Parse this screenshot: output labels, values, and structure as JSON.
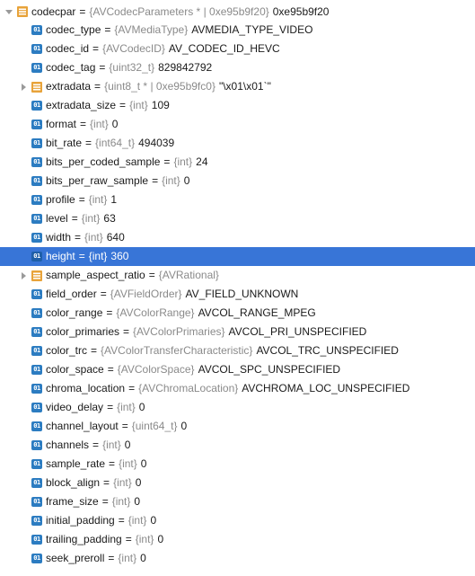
{
  "root": {
    "name": "codecpar",
    "type": "{AVCodecParameters * | 0xe95b9f20}",
    "value": "0xe95b9f20",
    "icon": "struct-icon",
    "expanded": true
  },
  "fields": [
    {
      "key": "codec_type",
      "name": "codec_type",
      "type": "{AVMediaType}",
      "value": "AVMEDIA_TYPE_VIDEO",
      "icon": "field-icon",
      "expandable": false
    },
    {
      "key": "codec_id",
      "name": "codec_id",
      "type": "{AVCodecID}",
      "value": "AV_CODEC_ID_HEVC",
      "icon": "field-icon",
      "expandable": false
    },
    {
      "key": "codec_tag",
      "name": "codec_tag",
      "type": "{uint32_t}",
      "value": "829842792",
      "icon": "field-icon",
      "expandable": false
    },
    {
      "key": "extradata",
      "name": "extradata",
      "type": "{uint8_t * | 0xe95b9fc0}",
      "value": "\"\\x01\\x01`\"",
      "icon": "struct-icon",
      "expandable": true
    },
    {
      "key": "extradata_size",
      "name": "extradata_size",
      "type": "{int}",
      "value": "109",
      "icon": "field-icon",
      "expandable": false
    },
    {
      "key": "format",
      "name": "format",
      "type": "{int}",
      "value": "0",
      "icon": "field-icon",
      "expandable": false
    },
    {
      "key": "bit_rate",
      "name": "bit_rate",
      "type": "{int64_t}",
      "value": "494039",
      "icon": "field-icon",
      "expandable": false
    },
    {
      "key": "bits_per_coded_sample",
      "name": "bits_per_coded_sample",
      "type": "{int}",
      "value": "24",
      "icon": "field-icon",
      "expandable": false
    },
    {
      "key": "bits_per_raw_sample",
      "name": "bits_per_raw_sample",
      "type": "{int}",
      "value": "0",
      "icon": "field-icon",
      "expandable": false
    },
    {
      "key": "profile",
      "name": "profile",
      "type": "{int}",
      "value": "1",
      "icon": "field-icon",
      "expandable": false
    },
    {
      "key": "level",
      "name": "level",
      "type": "{int}",
      "value": "63",
      "icon": "field-icon",
      "expandable": false
    },
    {
      "key": "width",
      "name": "width",
      "type": "{int}",
      "value": "640",
      "icon": "field-icon",
      "expandable": false
    },
    {
      "key": "height",
      "name": "height",
      "type": "{int}",
      "value": "360",
      "icon": "field-icon",
      "expandable": false,
      "selected": true
    },
    {
      "key": "sample_aspect_ratio",
      "name": "sample_aspect_ratio",
      "type": "{AVRational}",
      "value": "",
      "icon": "struct-icon",
      "expandable": true
    },
    {
      "key": "field_order",
      "name": "field_order",
      "type": "{AVFieldOrder}",
      "value": "AV_FIELD_UNKNOWN",
      "icon": "field-icon",
      "expandable": false
    },
    {
      "key": "color_range",
      "name": "color_range",
      "type": "{AVColorRange}",
      "value": "AVCOL_RANGE_MPEG",
      "icon": "field-icon",
      "expandable": false
    },
    {
      "key": "color_primaries",
      "name": "color_primaries",
      "type": "{AVColorPrimaries}",
      "value": "AVCOL_PRI_UNSPECIFIED",
      "icon": "field-icon",
      "expandable": false
    },
    {
      "key": "color_trc",
      "name": "color_trc",
      "type": "{AVColorTransferCharacteristic}",
      "value": "AVCOL_TRC_UNSPECIFIED",
      "icon": "field-icon",
      "expandable": false
    },
    {
      "key": "color_space",
      "name": "color_space",
      "type": "{AVColorSpace}",
      "value": "AVCOL_SPC_UNSPECIFIED",
      "icon": "field-icon",
      "expandable": false
    },
    {
      "key": "chroma_location",
      "name": "chroma_location",
      "type": "{AVChromaLocation}",
      "value": "AVCHROMA_LOC_UNSPECIFIED",
      "icon": "field-icon",
      "expandable": false
    },
    {
      "key": "video_delay",
      "name": "video_delay",
      "type": "{int}",
      "value": "0",
      "icon": "field-icon",
      "expandable": false
    },
    {
      "key": "channel_layout",
      "name": "channel_layout",
      "type": "{uint64_t}",
      "value": "0",
      "icon": "field-icon",
      "expandable": false
    },
    {
      "key": "channels",
      "name": "channels",
      "type": "{int}",
      "value": "0",
      "icon": "field-icon",
      "expandable": false
    },
    {
      "key": "sample_rate",
      "name": "sample_rate",
      "type": "{int}",
      "value": "0",
      "icon": "field-icon",
      "expandable": false
    },
    {
      "key": "block_align",
      "name": "block_align",
      "type": "{int}",
      "value": "0",
      "icon": "field-icon",
      "expandable": false
    },
    {
      "key": "frame_size",
      "name": "frame_size",
      "type": "{int}",
      "value": "0",
      "icon": "field-icon",
      "expandable": false
    },
    {
      "key": "initial_padding",
      "name": "initial_padding",
      "type": "{int}",
      "value": "0",
      "icon": "field-icon",
      "expandable": false
    },
    {
      "key": "trailing_padding",
      "name": "trailing_padding",
      "type": "{int}",
      "value": "0",
      "icon": "field-icon",
      "expandable": false
    },
    {
      "key": "seek_preroll",
      "name": "seek_preroll",
      "type": "{int}",
      "value": "0",
      "icon": "field-icon",
      "expandable": false
    }
  ],
  "colors": {
    "selection": "#3875d7",
    "field_icon": "#2c7cc1",
    "struct_icon": "#e8a33a",
    "type_text": "#8a8a8a"
  }
}
